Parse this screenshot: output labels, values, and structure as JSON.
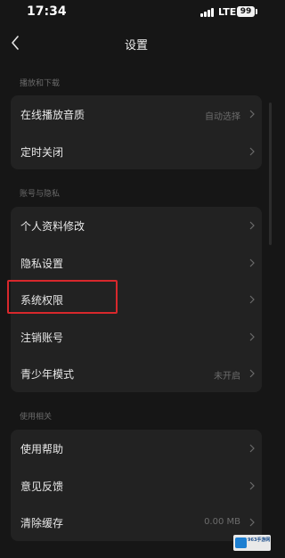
{
  "status_bar": {
    "time": "17:34",
    "network": "LTE",
    "battery": "99"
  },
  "header": {
    "title": "设置"
  },
  "sections": [
    {
      "header": "播放和下载",
      "items": [
        {
          "label": "在线播放音质",
          "value": "自动选择"
        },
        {
          "label": "定时关闭",
          "value": ""
        }
      ]
    },
    {
      "header": "账号与隐私",
      "items": [
        {
          "label": "个人资料修改",
          "value": ""
        },
        {
          "label": "隐私设置",
          "value": ""
        },
        {
          "label": "系统权限",
          "value": ""
        },
        {
          "label": "注销账号",
          "value": ""
        },
        {
          "label": "青少年模式",
          "value": "未开启"
        }
      ]
    },
    {
      "header": "使用相关",
      "items": [
        {
          "label": "使用帮助",
          "value": ""
        },
        {
          "label": "意见反馈",
          "value": ""
        },
        {
          "label": "清除缓存",
          "value": "0.00 MB"
        }
      ]
    }
  ],
  "watermark": {
    "text": "963手游网"
  },
  "colors": {
    "background": "#161616",
    "card": "#222222",
    "highlight": "#d8282c"
  }
}
